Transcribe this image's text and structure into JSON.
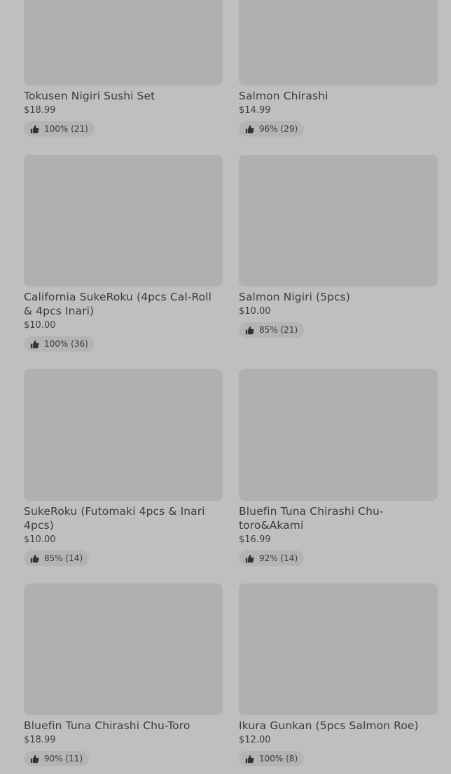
{
  "items": [
    {
      "name": "Tokusen Nigiri Sushi Set",
      "price": "$18.99",
      "rating": "100% (21)",
      "icon": "thumbs-up-icon"
    },
    {
      "name": "Salmon Chirashi",
      "price": "$14.99",
      "rating": "96% (29)",
      "icon": "thumbs-up-icon"
    },
    {
      "name": "California SukeRoku (4pcs Cal-Roll & 4pcs Inari)",
      "price": "$10.00",
      "rating": "100% (36)",
      "icon": "thumbs-up-icon"
    },
    {
      "name": "Salmon Nigiri (5pcs)",
      "price": "$10.00",
      "rating": "85% (21)",
      "icon": "thumbs-up-icon"
    },
    {
      "name": "SukeRoku (Futomaki 4pcs & Inari 4pcs)",
      "price": "$10.00",
      "rating": "85% (14)",
      "icon": "thumbs-up-icon"
    },
    {
      "name": "Bluefin Tuna Chirashi Chu-toro&Akami",
      "price": "$16.99",
      "rating": "92% (14)",
      "icon": "thumbs-up-icon"
    },
    {
      "name": "Bluefin Tuna Chirashi Chu-Toro",
      "price": "$18.99",
      "rating": "90% (11)",
      "icon": "thumbs-up-icon"
    },
    {
      "name": "Ikura Gunkan (5pcs Salmon Roe)",
      "price": "$12.00",
      "rating": "100% (8)",
      "icon": "thumbs-up-icon"
    }
  ],
  "colors": {
    "background": "#bfbfbf",
    "image_placeholder": "#b0b0b0",
    "rating_pill": "#b4b4b4",
    "text": "#3b3b3b"
  }
}
